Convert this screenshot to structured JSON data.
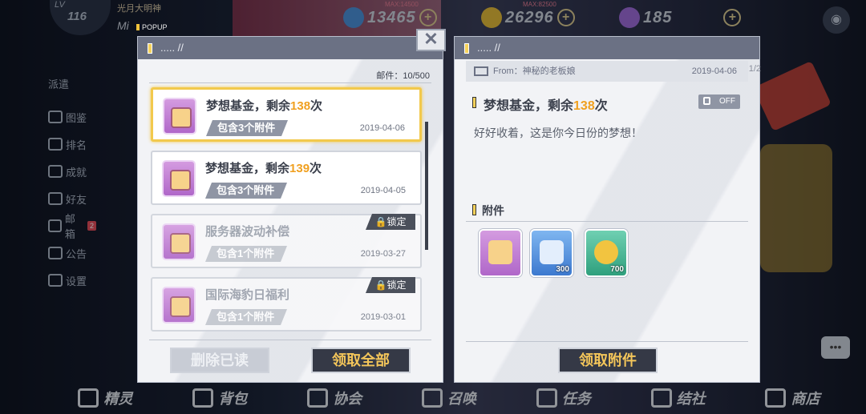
{
  "hud": {
    "level_label": "LV",
    "level": "116",
    "player_name": "光月大明神",
    "player_name2": "Mi",
    "resources": [
      {
        "icon": "energy-icon",
        "max": "MAX:14500",
        "value": "13465",
        "color": "#4a8fd8"
      },
      {
        "icon": "gold-coin-icon",
        "max": "MAX:82500",
        "value": "26296",
        "color": "#e0b83a"
      },
      {
        "icon": "gem-icon",
        "max": "",
        "value": "185",
        "color": "#9b6ad8"
      }
    ]
  },
  "popup_tag": "POPUP",
  "sidebar": {
    "first": "派遣",
    "items": [
      {
        "label": "图鉴",
        "icon": "book-icon"
      },
      {
        "label": "排名",
        "icon": "ranking-icon"
      },
      {
        "label": "成就",
        "icon": "trophy-icon"
      },
      {
        "label": "好友",
        "icon": "friends-icon"
      },
      {
        "label": "邮箱",
        "icon": "mail-icon",
        "badge": "2"
      },
      {
        "label": "公告",
        "icon": "megaphone-icon"
      },
      {
        "label": "设置",
        "icon": "gear-icon"
      }
    ]
  },
  "bottom_nav": [
    {
      "label": "精灵",
      "icon": "sprite-icon"
    },
    {
      "label": "背包",
      "icon": "bag-icon"
    },
    {
      "label": "协会",
      "icon": "guild-icon"
    },
    {
      "label": "召唤",
      "icon": "summon-icon"
    },
    {
      "label": "任务",
      "icon": "quest-icon"
    },
    {
      "label": "结社",
      "icon": "club-icon"
    },
    {
      "label": "商店",
      "icon": "shop-icon"
    }
  ],
  "mail_list": {
    "title": "..... //",
    "count": "邮件：10/500",
    "items": [
      {
        "title_prefix": "梦想基金，剩余",
        "title_hl": "138",
        "title_suffix": "次",
        "attachment": "包含3个附件",
        "date": "2019-04-06",
        "locked": false,
        "selected": true
      },
      {
        "title_prefix": "梦想基金，剩余",
        "title_hl": "139",
        "title_suffix": "次",
        "attachment": "包含3个附件",
        "date": "2019-04-05",
        "locked": false,
        "selected": false
      },
      {
        "title_prefix": "服务器波动补偿",
        "title_hl": "",
        "title_suffix": "",
        "attachment": "包含1个附件",
        "date": "2019-03-27",
        "locked": true,
        "lock_label": "锁定",
        "selected": false
      },
      {
        "title_prefix": "国际海豹日福利",
        "title_hl": "",
        "title_suffix": "",
        "attachment": "包含1个附件",
        "date": "2019-03-01",
        "locked": true,
        "lock_label": "锁定",
        "selected": false
      }
    ],
    "delete_read_label": "删除已读",
    "claim_all_label": "领取全部"
  },
  "mail_detail": {
    "title": "..... //",
    "from": "From：神秘的老板娘",
    "date": "2019-04-06",
    "subject_prefix": "梦想基金，剩余",
    "subject_hl": "138",
    "subject_suffix": "次",
    "lock_toggle": "OFF",
    "body": "好好收着，这是你今日份的梦想！",
    "attachments_title": "附件",
    "attachments": [
      {
        "icon": "ticket-icon",
        "qty": "",
        "color": "#c57ad8"
      },
      {
        "icon": "energy-drink-icon",
        "qty": "300",
        "color": "#4a8fd8"
      },
      {
        "icon": "gold-coin-icon",
        "qty": "700",
        "color": "#2fb28a"
      }
    ],
    "claim_label": "领取附件"
  },
  "page_indicator": "1/2"
}
